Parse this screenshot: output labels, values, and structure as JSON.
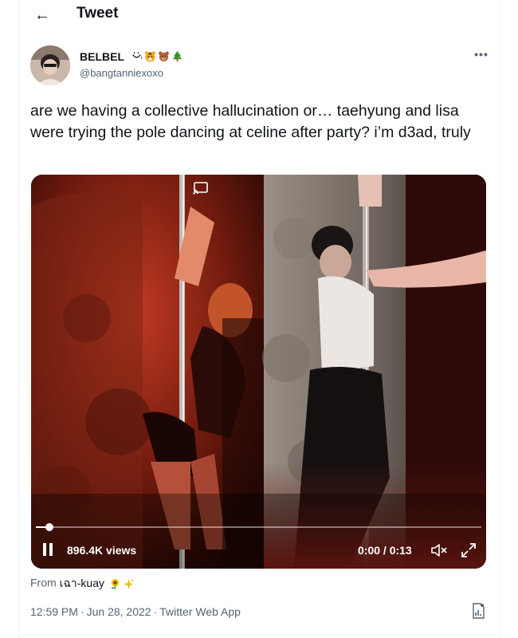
{
  "header": {
    "back_icon": "arrow-left-icon",
    "title": "Tweet"
  },
  "author": {
    "display_name": "BELBEL",
    "display_name_emoji": [
      "smiling-face-icon",
      "tiger-face-icon",
      "bear-face-icon",
      "christmas-tree-icon"
    ],
    "handle": "@bangtanniexoxo",
    "more_label": "•••"
  },
  "tweet": {
    "text": "are we having a collective hallucination or… taehyung and lisa were trying the pole dancing at celine after party? i’m d3ad, truly"
  },
  "video": {
    "views": "896.4K views",
    "time": "0:00 / 0:13",
    "progress": 0.03,
    "icons": [
      "cast-icon",
      "pause-icon",
      "mute-icon",
      "fullscreen-icon"
    ]
  },
  "source": {
    "prefix": "From",
    "user": "เฉา-kuay",
    "emoji": [
      "sunflower-icon",
      "sparkles-icon"
    ]
  },
  "meta": {
    "time": "12:59 PM",
    "date": "Jun 28, 2022",
    "client": "Twitter Web App",
    "separator": "·"
  },
  "colors": {
    "text_primary": "#0f1419",
    "text_secondary": "#536471",
    "divider": "#eff3f4"
  }
}
